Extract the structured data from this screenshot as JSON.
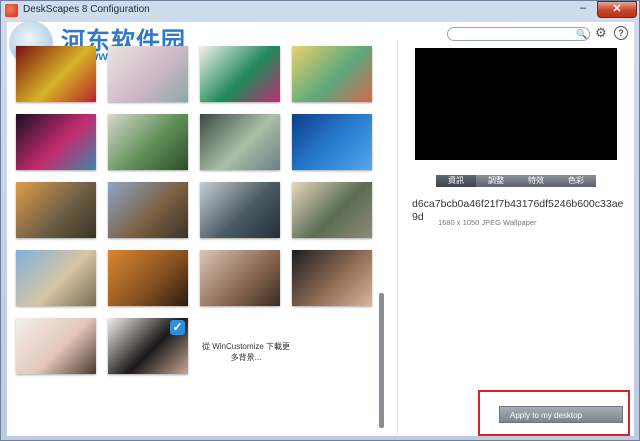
{
  "window": {
    "title": "DeskScapes 8 Configuration",
    "minimize_label": "–",
    "close_label": "✕"
  },
  "watermark": {
    "line1": "河东软件园",
    "line2": "www.pc0359.cn"
  },
  "toolbar": {
    "search_placeholder": "",
    "search_icon": "🔍",
    "gear_icon": "⚙",
    "help_icon": "?"
  },
  "gallery": {
    "more_link": "從 WinCustomize 下載更多背景...",
    "thumbnails": [
      {
        "name": "red-abstract",
        "colors": [
          "#7a1010",
          "#d8b326",
          "#b4252a"
        ],
        "selected": false
      },
      {
        "name": "pastel-flowers",
        "colors": [
          "#e8e6df",
          "#cfb7c9",
          "#8ca9a4"
        ],
        "selected": false
      },
      {
        "name": "colorful-tree",
        "colors": [
          "#f4f2ea",
          "#1d8a5a",
          "#c02c72"
        ],
        "selected": false
      },
      {
        "name": "fantasy-land",
        "colors": [
          "#e9d36a",
          "#5aa87d",
          "#d8654d"
        ],
        "selected": false
      },
      {
        "name": "neon-circles",
        "colors": [
          "#1a1022",
          "#c42b6e",
          "#3b88a6"
        ],
        "selected": false
      },
      {
        "name": "green-forest",
        "colors": [
          "#d7d9cd",
          "#5f8f56",
          "#2c4d2c"
        ],
        "selected": false
      },
      {
        "name": "geometric-shards",
        "colors": [
          "#3c4a45",
          "#a9c0a7",
          "#6a7f86"
        ],
        "selected": false
      },
      {
        "name": "windows-7",
        "colors": [
          "#0c3f8a",
          "#2a7fd3",
          "#54a8e8"
        ],
        "selected": false
      },
      {
        "name": "river-sunset",
        "colors": [
          "#e39b4b",
          "#6f6147",
          "#3a3324"
        ],
        "selected": false
      },
      {
        "name": "great-wall",
        "colors": [
          "#8ea6c7",
          "#7c6243",
          "#3b3226"
        ],
        "selected": false
      },
      {
        "name": "mountain-peaks",
        "colors": [
          "#c8cdd4",
          "#4a5a63",
          "#253039"
        ],
        "selected": false
      },
      {
        "name": "rice-terraces",
        "colors": [
          "#e7d7bd",
          "#5a6d52",
          "#8f8a7a"
        ],
        "selected": false
      },
      {
        "name": "beach-rocks",
        "colors": [
          "#7fb0db",
          "#d7c6a4",
          "#7a6a52"
        ],
        "selected": false
      },
      {
        "name": "golden-bridge",
        "colors": [
          "#d9872c",
          "#8c5422",
          "#2b1a10"
        ],
        "selected": false
      },
      {
        "name": "woman-portrait",
        "colors": [
          "#d9c7b6",
          "#8d6b55",
          "#3a2b22"
        ],
        "selected": false
      },
      {
        "name": "man-portrait",
        "colors": [
          "#1c1d1f",
          "#8e6c55",
          "#d8b79a"
        ],
        "selected": false
      },
      {
        "name": "woman-smile",
        "colors": [
          "#f3f0ee",
          "#e3c7b8",
          "#4a3a33"
        ],
        "selected": false
      },
      {
        "name": "woman-hair",
        "colors": [
          "#f1eeea",
          "#1a1818",
          "#c6a898"
        ],
        "selected": true
      }
    ]
  },
  "details": {
    "tabs": [
      "資訊",
      "調整",
      "特效",
      "色彩"
    ],
    "active_tab": 0,
    "hash": "d6ca7bcb0a46f21f7b43176df5246b600c33ae9d",
    "meta": "1680 x 1050 JPEG Wallpaper",
    "apply_label": "Apply to my desktop"
  },
  "colors": {
    "accent": "#2f78c9",
    "highlight_border": "#d42626"
  }
}
